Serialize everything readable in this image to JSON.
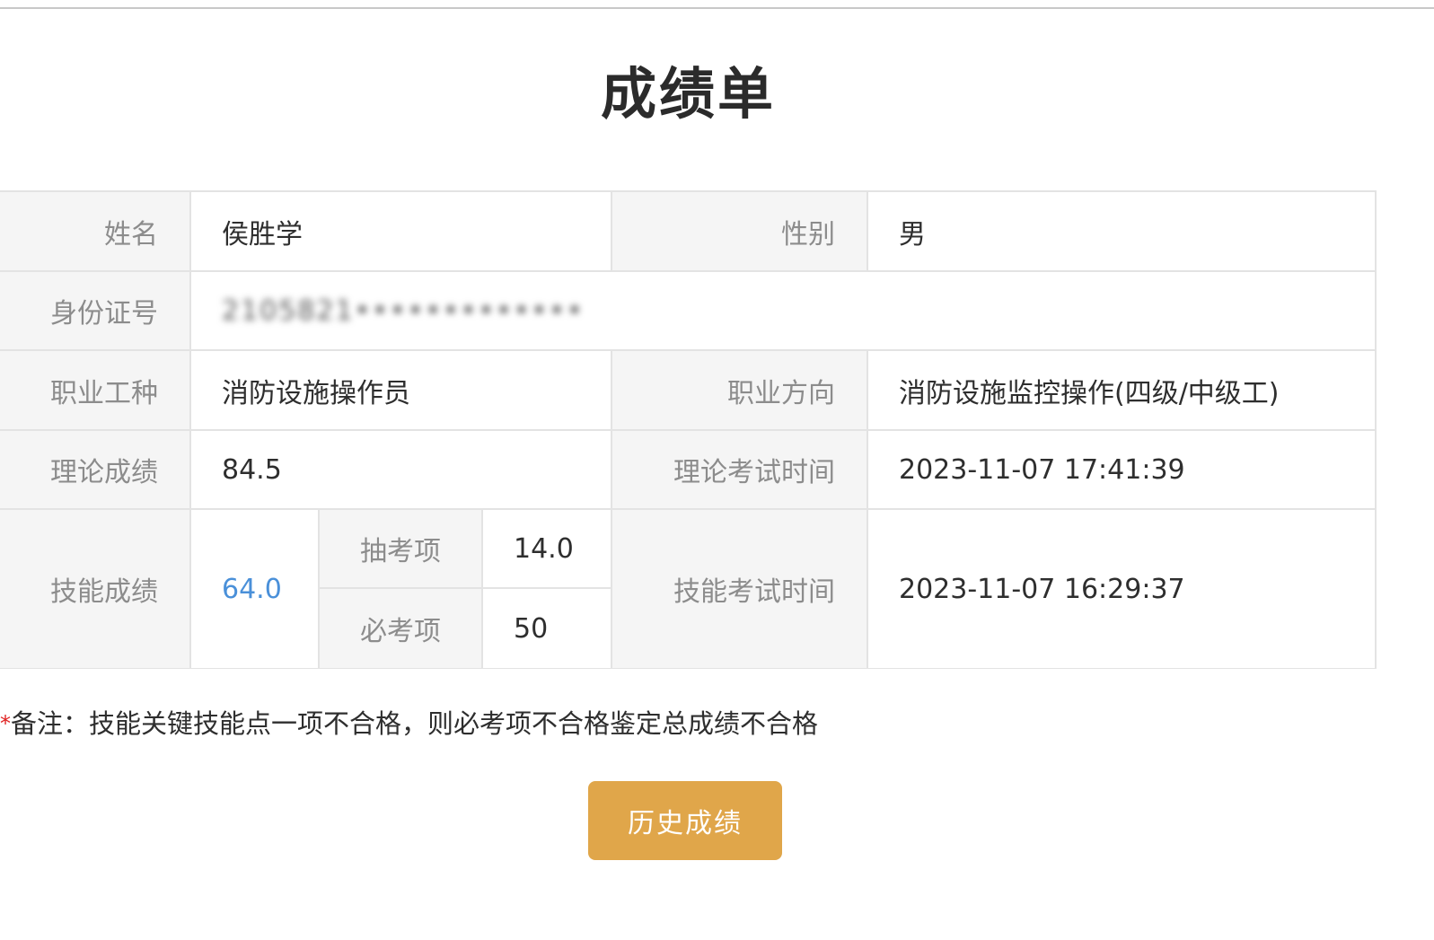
{
  "title": "成绩单",
  "table": {
    "name_label": "姓名",
    "name_value": "侯胜学",
    "gender_label": "性别",
    "gender_value": "男",
    "id_label": "身份证号",
    "id_value_blurred": "2105821•••••••••••••",
    "occupation_label": "职业工种",
    "occupation_value": "消防设施操作员",
    "direction_label": "职业方向",
    "direction_value": "消防设施监控操作(四级/中级工)",
    "theory_score_label": "理论成绩",
    "theory_score_value": "84.5",
    "theory_time_label": "理论考试时间",
    "theory_time_value": "2023-11-07 17:41:39",
    "skill_score_label": "技能成绩",
    "skill_score_value": "64.0",
    "sampled_item_label": "抽考项",
    "sampled_item_value": "14.0",
    "required_item_label": "必考项",
    "required_item_value": "50",
    "skill_time_label": "技能考试时间",
    "skill_time_value": "2023-11-07 16:29:37"
  },
  "note": {
    "asterisk": "*",
    "text": "备注：技能关键技能点一项不合格，则必考项不合格鉴定总成绩不合格"
  },
  "buttons": {
    "history_label": "历史成绩"
  },
  "colors": {
    "button_bg": "#e0a64a",
    "link_blue": "#4a90d9",
    "label_bg": "#f5f5f5",
    "asterisk_red": "#e02020"
  }
}
